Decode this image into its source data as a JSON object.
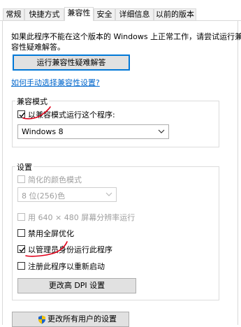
{
  "tabs": [
    {
      "label": "常规",
      "active": false
    },
    {
      "label": "快捷方式",
      "active": false
    },
    {
      "label": "兼容性",
      "active": true
    },
    {
      "label": "安全",
      "active": false
    },
    {
      "label": "详细信息",
      "active": false
    },
    {
      "label": "以前的版本",
      "active": false
    }
  ],
  "intro": {
    "line1": "如果此程序不能在这个版本的 Windows 上正常工作，请尝试运行兼",
    "line2": "容性疑难解答。"
  },
  "troubleshooter_button": "运行兼容性疑难解答",
  "manual_link": "如何手动选择兼容性设置?",
  "compat_mode": {
    "title": "兼容模式",
    "checkbox_label": "以兼容模式运行这个程序:",
    "checked": true,
    "selected_os": "Windows 8"
  },
  "settings": {
    "title": "设置",
    "reduced_color": {
      "label": "简化的颜色模式",
      "checked": false,
      "enabled": false
    },
    "color_select": {
      "value": "8 位(256)色",
      "enabled": false
    },
    "res_640": {
      "label": "用 640 × 480 屏幕分辨率运行",
      "checked": false,
      "enabled": false
    },
    "disable_fullscreen": {
      "label": "禁用全屏优化",
      "checked": false,
      "enabled": true
    },
    "run_as_admin": {
      "label": "以管理员身份运行此程序",
      "checked": true,
      "enabled": true
    },
    "register_restart": {
      "label": "注册此程序以重新启动",
      "checked": false,
      "enabled": true
    },
    "dpi_button": "更改高 DPI 设置"
  },
  "all_users_button": "更改所有用户的设置",
  "colors": {
    "link": "#0066cc",
    "focus_border": "#0078d7",
    "annotation_red": "#e0001a",
    "shield_blue": "#1e63c6",
    "shield_yellow": "#f5c400"
  }
}
